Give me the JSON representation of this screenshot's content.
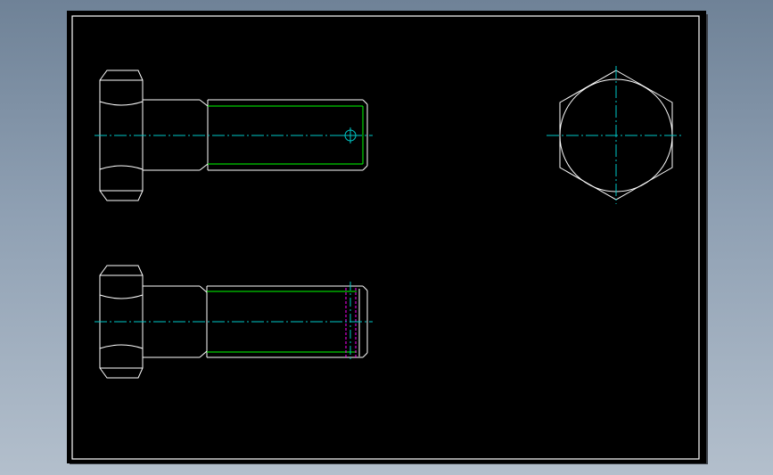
{
  "drawing": {
    "background": "#000000",
    "border_color": "#ffffff",
    "colors": {
      "outline": "#ffffff",
      "thread": "#00ff00",
      "centerline": "#00c8c8",
      "hidden": "#ff00ff",
      "sheet_shadow": "#3a3f46"
    },
    "views": [
      {
        "name": "bolt-side-view-drilled",
        "feature": "cross-hole"
      },
      {
        "name": "bolt-side-view-threaded",
        "feature": "thread-end-lines"
      },
      {
        "name": "bolt-end-view-hexagon",
        "feature": "hex-head"
      }
    ]
  }
}
